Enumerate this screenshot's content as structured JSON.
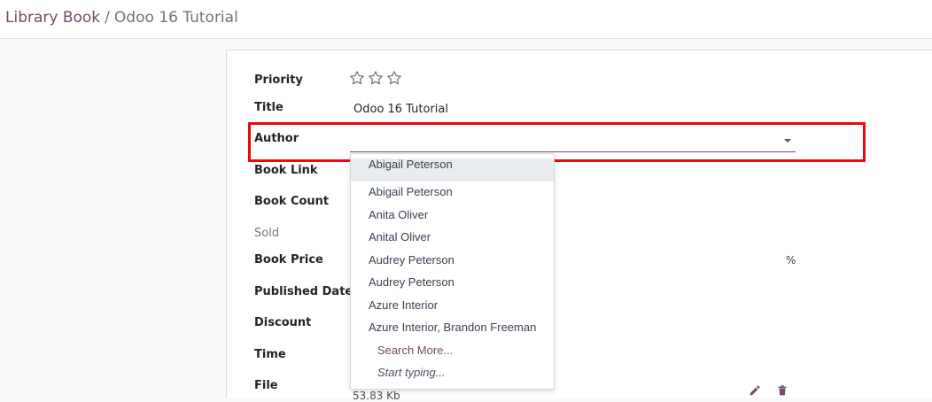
{
  "breadcrumb": {
    "parent": "Library Book",
    "separator": "/",
    "current": "Odoo 16 Tutorial"
  },
  "form": {
    "labels": {
      "priority": "Priority",
      "title": "Title",
      "author": "Author",
      "book_link": "Book Link",
      "book_count": "Book Count",
      "sold": "Sold",
      "book_price": "Book Price",
      "published_date": "Published Date",
      "discount": "Discount",
      "time": "Time",
      "file": "File"
    },
    "priority_stars": 3,
    "priority_value": 0,
    "title_value": "Odoo 16  Tutorial",
    "author_value": "",
    "discount_unit": "%",
    "file_size": "53.83 Kb"
  },
  "author_dropdown": {
    "items": [
      "Abigail Peterson",
      "Abigail Peterson",
      "Anita Oliver",
      "Anital Oliver",
      "Audrey Peterson",
      "Audrey Peterson",
      "Azure Interior",
      "Azure Interior, Brandon Freeman"
    ],
    "search_more": "Search More...",
    "start_typing": "Start typing..."
  },
  "colors": {
    "brand": "#714b67",
    "highlight": "#e8090f",
    "delete": "#714b67"
  },
  "icons": {
    "priority": "star-outline-icon",
    "author_toggle": "caret-down-icon",
    "file_edit": "pencil-icon",
    "file_delete": "trash-icon"
  }
}
